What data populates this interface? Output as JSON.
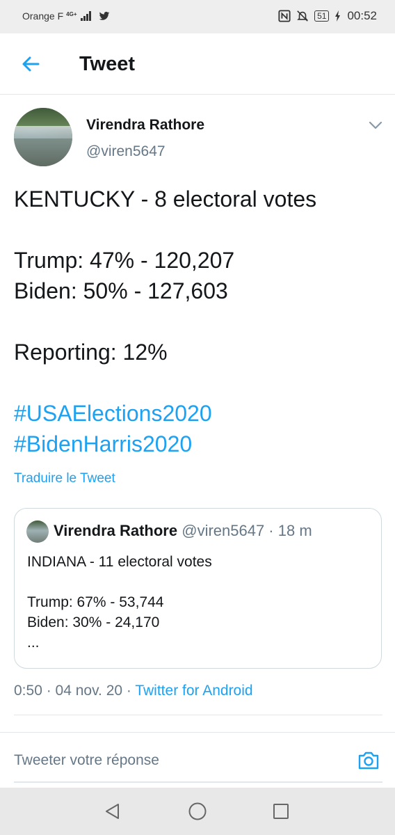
{
  "status_bar": {
    "carrier": "Orange F",
    "network": "4G+",
    "battery": "51",
    "time": "00:52"
  },
  "header": {
    "title": "Tweet"
  },
  "tweet": {
    "author_name": "Virendra Rathore",
    "author_handle": "@viren5647",
    "lines": [
      "KENTUCKY - 8 electoral votes",
      "Trump: 47% - 120,207",
      "Biden: 50% - 127,603",
      "Reporting: 12%"
    ],
    "hashtags": [
      "#USAElections2020",
      "#BidenHarris2020"
    ],
    "translate_label": "Traduire le Tweet",
    "timestamp": "0:50 · 04 nov. 20 · ",
    "source": "Twitter for Android"
  },
  "quoted_tweet": {
    "author_name": "Virendra Rathore",
    "meta": "@viren5647 · 18 m",
    "lines": [
      "INDIANA - 11 electoral votes",
      "Trump: 67% - 53,744",
      "Biden: 30% - 24,170",
      "..."
    ]
  },
  "reply": {
    "placeholder": "Tweeter votre réponse"
  },
  "icons": {
    "back": "arrow-left-icon",
    "caret": "chevron-down-icon",
    "camera": "camera-icon",
    "nav_back": "triangle-back-icon",
    "nav_home": "circle-home-icon",
    "nav_recent": "square-recent-icon"
  },
  "colors": {
    "accent": "#1da1f2",
    "text": "#14171a",
    "muted": "#657786"
  }
}
